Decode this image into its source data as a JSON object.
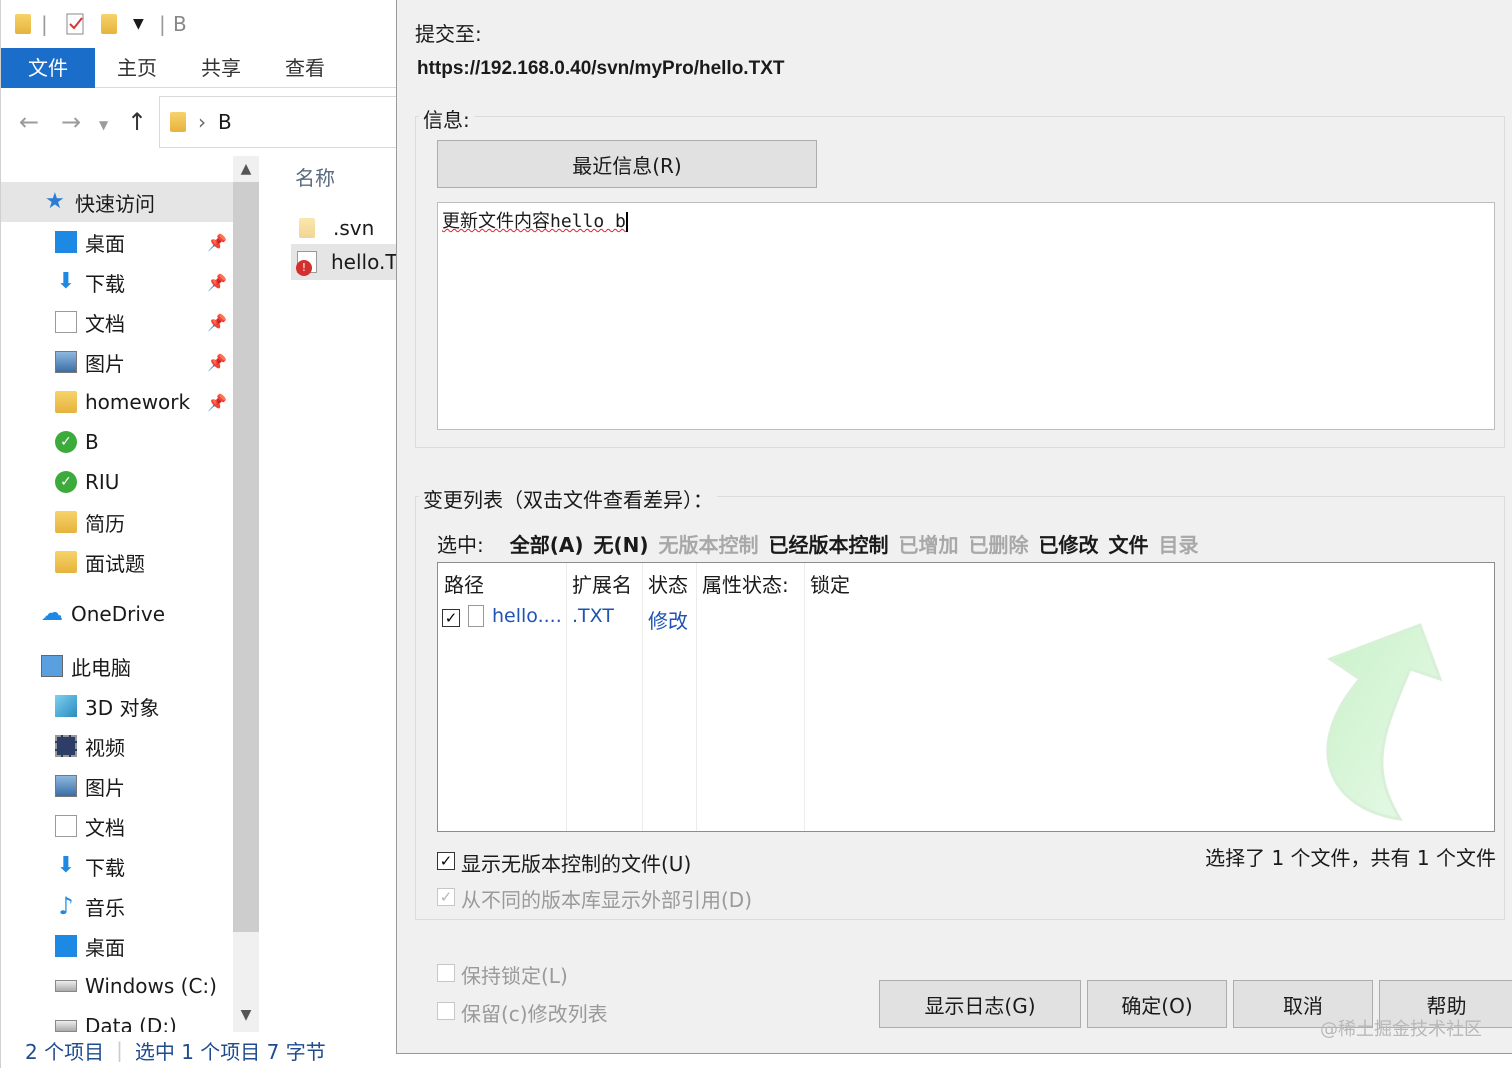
{
  "explorer": {
    "qat_title": "B",
    "ribbon_tabs": [
      "文件",
      "主页",
      "共享",
      "查看"
    ],
    "address_segment": "B",
    "nav_items": [
      {
        "label": "快速访问",
        "icon": "star-icon"
      },
      {
        "label": "桌面",
        "icon": "desktop-icon"
      },
      {
        "label": "下载",
        "icon": "download-icon"
      },
      {
        "label": "文档",
        "icon": "document-icon"
      },
      {
        "label": "图片",
        "icon": "picture-icon"
      },
      {
        "label": "homework",
        "icon": "folder-icon"
      },
      {
        "label": "B",
        "icon": "svn-folder-icon"
      },
      {
        "label": "RIU",
        "icon": "svn-folder-icon"
      },
      {
        "label": "简历",
        "icon": "folder-icon"
      },
      {
        "label": "面试题",
        "icon": "folder-icon"
      },
      {
        "label": "OneDrive",
        "icon": "cloud-icon"
      },
      {
        "label": "此电脑",
        "icon": "computer-icon"
      },
      {
        "label": "3D 对象",
        "icon": "cube-icon"
      },
      {
        "label": "视频",
        "icon": "video-icon"
      },
      {
        "label": "图片",
        "icon": "picture-icon"
      },
      {
        "label": "文档",
        "icon": "document-icon"
      },
      {
        "label": "下载",
        "icon": "download-icon"
      },
      {
        "label": "音乐",
        "icon": "music-icon"
      },
      {
        "label": "桌面",
        "icon": "desktop-icon"
      },
      {
        "label": "Windows (C:)",
        "icon": "drive-icon"
      },
      {
        "label": "Data (D:)",
        "icon": "drive-icon"
      }
    ],
    "file_header": "名称",
    "files": [
      ".svn",
      "hello.T"
    ],
    "status_items": "2 个项目",
    "status_selected": "选中 1 个项目  7 字节"
  },
  "dialog": {
    "commit_to_label": "提交至:",
    "commit_url": "https://192.168.0.40/svn/myPro/hello.TXT",
    "message_group": "信息:",
    "recent_button": "最近信息(R)",
    "message_text": "更新文件内容hello b",
    "changes_group": "变更列表（双击文件查看差异）：",
    "select_label": "选中:",
    "filters": [
      {
        "label": "全部(A)",
        "enabled": true
      },
      {
        "label": "无(N)",
        "enabled": true
      },
      {
        "label": "无版本控制",
        "enabled": false
      },
      {
        "label": "已经版本控制",
        "enabled": true
      },
      {
        "label": "已增加",
        "enabled": false
      },
      {
        "label": "已删除",
        "enabled": false
      },
      {
        "label": "已修改",
        "enabled": true
      },
      {
        "label": "文件",
        "enabled": true
      },
      {
        "label": "目录",
        "enabled": false
      }
    ],
    "columns": [
      "路径",
      "扩展名",
      "状态",
      "属性状态:",
      "锁定"
    ],
    "rows": [
      {
        "path": "hello....",
        "ext": ".TXT",
        "status": "修改",
        "checked": true
      }
    ],
    "show_unversioned": "显示无版本控制的文件(U)",
    "show_externals": "从不同的版本库显示外部引用(D)",
    "selection_summary": "选择了 1 个文件，共有 1 个文件",
    "keep_locks": "保持锁定(L)",
    "keep_changelists": "保留(c)修改列表",
    "buttons": {
      "show_log": "显示日志(G)",
      "ok": "确定(O)",
      "cancel": "取消",
      "help": "帮助"
    },
    "watermark": "@稀土掘金技术社区"
  }
}
